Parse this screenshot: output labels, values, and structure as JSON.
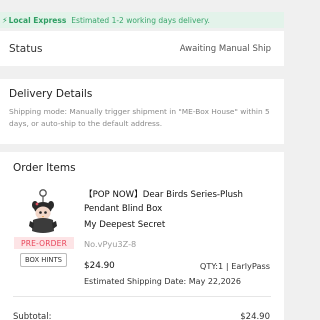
{
  "banner": {
    "icon": "lightning-bolt-icon",
    "bolt": "⚡",
    "label": "Local Express",
    "message": "Estimated 1-2 working days delivery."
  },
  "status": {
    "label": "Status",
    "value": "Awaiting Manual Ship"
  },
  "delivery": {
    "title": "Delivery Details",
    "text": "Shipping mode: Manually trigger shipment in \"ME-Box House\" within 5 days, or auto-ship to the default address."
  },
  "order": {
    "title": "Order Items",
    "item": {
      "name": "【POP NOW】Dear Birds Series-Plush Pendant Blind Box",
      "variant": "My Deepest Secret",
      "sku": "No.vPyu3Z-8",
      "price": "$24.90",
      "qty": "QTY:1 | EarlyPass",
      "shipping_date": "Estimated Shipping Date: May 22,2026",
      "badge": "PRE-ORDER",
      "box_hints": "BOX HINTS"
    },
    "subtotal_label": "Subtotal:",
    "subtotal_value": "$24.90"
  },
  "colors": {
    "accent_green": "#2f9e63",
    "preorder_red": "#e8455a",
    "background": "#f0f0f0"
  }
}
